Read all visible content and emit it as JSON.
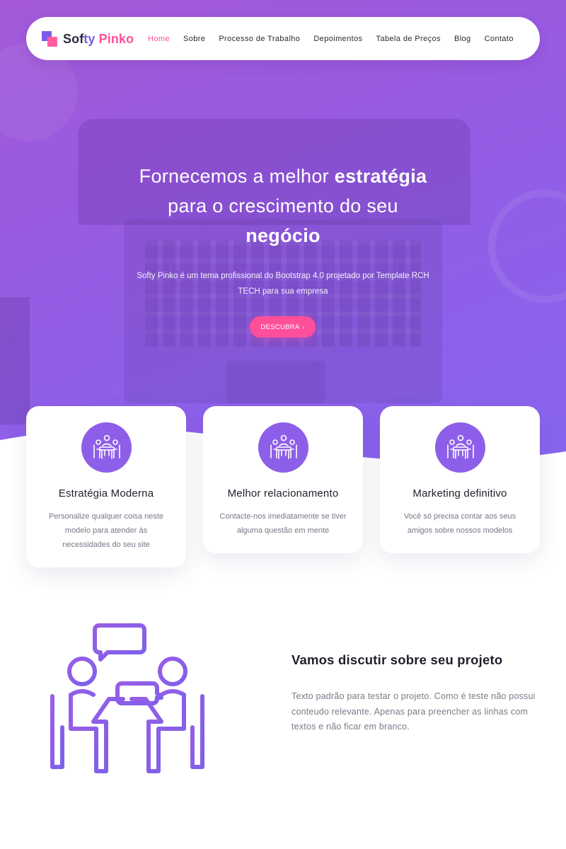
{
  "brand": {
    "name_part1": "Sof",
    "name_part2": "ty",
    "name_part3": " Pinko",
    "colors": {
      "primary": "#8d5fe8",
      "accent": "#ff4f9a",
      "hero_start": "#a45ad8",
      "hero_end": "#8766ef"
    }
  },
  "nav": {
    "items": [
      {
        "label": "Home",
        "active": true
      },
      {
        "label": "Sobre",
        "active": false
      },
      {
        "label": "Processo de Trabalho",
        "active": false
      },
      {
        "label": "Depoimentos",
        "active": false
      },
      {
        "label": "Tabela de Preços",
        "active": false
      },
      {
        "label": "Blog",
        "active": false
      },
      {
        "label": "Contato",
        "active": false
      }
    ]
  },
  "hero": {
    "title_line1": "Fornecemos a melhor ",
    "title_bold1": "estratégia",
    "title_line2": "para o crescimento do seu",
    "title_bold2": "negócio",
    "subtitle_line1": "Softy Pinko é um tema profissional do Bootstrap 4.0 projetado por Template RCH",
    "subtitle_line2": "TECH para sua empresa",
    "cta_label": "DESCUBRA",
    "cta_icon": "chevron-right-icon"
  },
  "features": [
    {
      "icon": "team-meeting-icon",
      "title": "Estratégia Moderna",
      "text": "Personalize qualquer coisa neste modelo para atender às necessidades do seu site"
    },
    {
      "icon": "team-meeting-icon",
      "title": "Melhor relacionamento",
      "text": "Contacte-nos imediatamente se tiver alguma questão em mente"
    },
    {
      "icon": "team-meeting-icon",
      "title": "Marketing definitivo",
      "text": "Você só precisa contar aos seus amigos sobre nossos modelos"
    }
  ],
  "discuss": {
    "illustration": "people-discussion-icon",
    "title": "Vamos discutir sobre seu projeto",
    "text": "Texto padrão para testar o projeto. Como é teste não possui conteudo relevante. Apenas para preencher as linhas com textos e não ficar em branco."
  }
}
